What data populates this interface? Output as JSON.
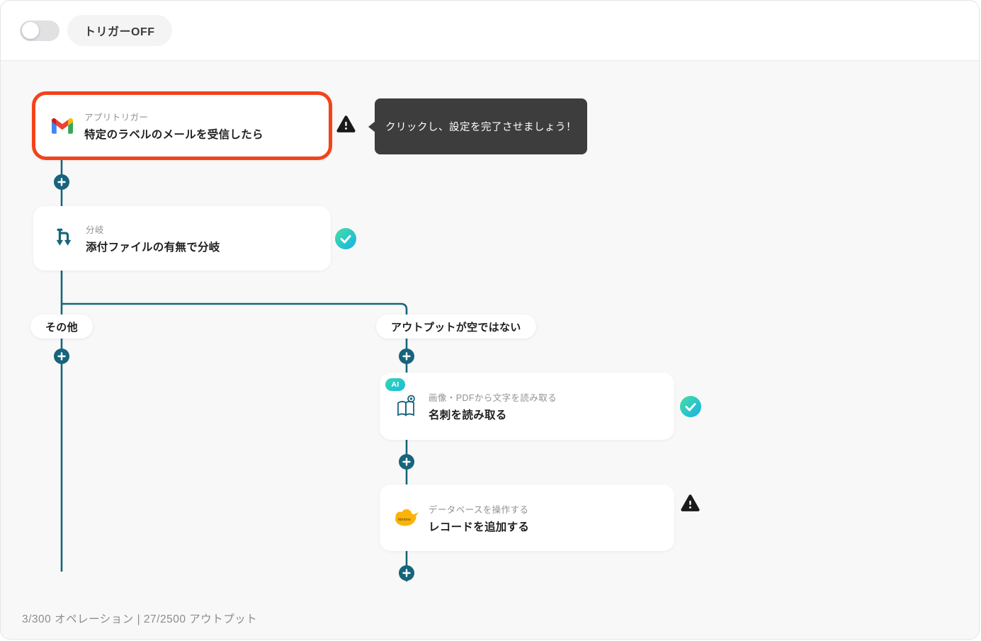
{
  "header": {
    "trigger_toggle_state": "off",
    "trigger_label": "トリガーOFF"
  },
  "tooltip": {
    "text": "クリックし、設定を完了させましょう！"
  },
  "nodes": [
    {
      "id": "trigger",
      "app": "Gmail",
      "type_label": "アプリトリガー",
      "title": "特定のラベルのメールを受信したら",
      "status": "warning",
      "highlighted": true
    },
    {
      "id": "branch",
      "type_label": "分岐",
      "title": "添付ファイルの有無で分岐",
      "status": "ok"
    },
    {
      "id": "ocr",
      "badge": "AI",
      "type_label": "画像・PDFから文字を読み取る",
      "title": "名刺を読み取る",
      "status": "ok"
    },
    {
      "id": "kintone",
      "app": "kintone",
      "type_label": "データベースを操作する",
      "title": "レコードを追加する",
      "status": "warning"
    }
  ],
  "branches": {
    "left_label": "その他",
    "right_label": "アウトプットが空ではない"
  },
  "footer": {
    "usage": "3/300 オペレーション | 27/2500 アウトプット"
  },
  "colors": {
    "connector_teal": "#17647c",
    "highlight_red": "#f3431c",
    "check_gradient_start": "#44dfa2",
    "check_gradient_end": "#18b1e8",
    "warning_black": "#1a1a1a",
    "canvas_bg": "#f8f8f8",
    "kintone_yellow": "#fbb309"
  }
}
